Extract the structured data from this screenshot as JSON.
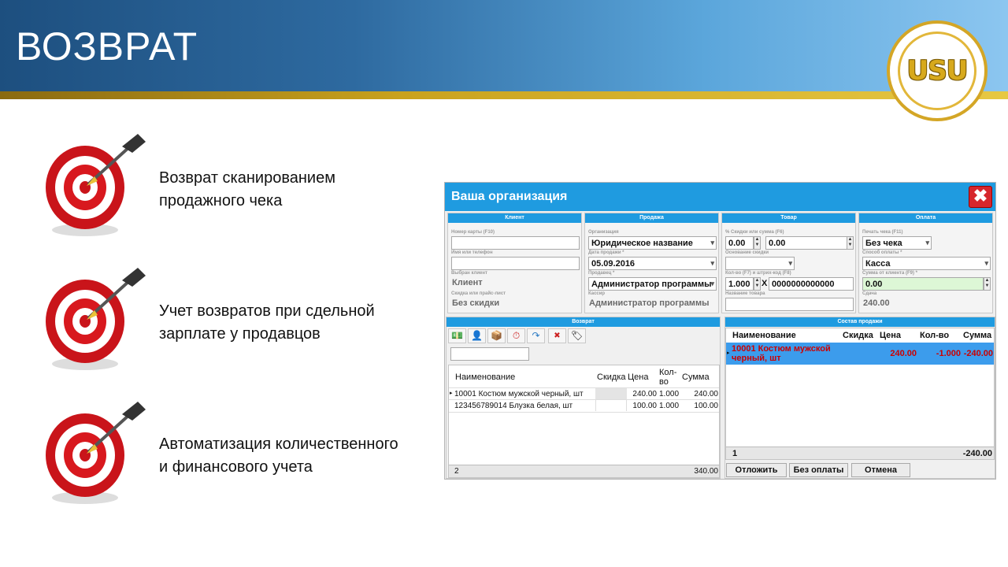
{
  "slide": {
    "title": "ВОЗВРАТ",
    "logo_text": "USU",
    "bullets": [
      {
        "line1": "Возврат сканированием",
        "line2": "продажного чека"
      },
      {
        "line1": "Учет возвратов при сдельной",
        "line2": "зарплате у продавцов"
      },
      {
        "line1": "Автоматизация количественного",
        "line2": "и финансового учета"
      }
    ]
  },
  "app": {
    "window_title": "Ваша организация",
    "close_glyph": "✖",
    "client": {
      "header": "Клиент",
      "card_label": "Номер карты (F10)",
      "name_label": "Имя или телефон",
      "selected_label": "Выбран клиент",
      "selected_value": "Клиент",
      "discount_label": "Скидка или прайс-лист",
      "discount_value": "Без скидки"
    },
    "sale": {
      "header": "Продажа",
      "org_label": "Организация",
      "org_value": "Юридическое название",
      "date_label": "Дата продажи *",
      "date_value": "05.09.2016",
      "seller_label": "Продавец *",
      "seller_value": "Администратор программы",
      "cashier_label": "Кассир",
      "cashier_value": "Администратор программы"
    },
    "product": {
      "header": "Товар",
      "discount_label": "% Скидки или сумма (F6)",
      "discount_pct": "0.00",
      "discount_sum": "0.00",
      "reason_label": "Основание скидки",
      "qty_label": "Кол-во (F7) и штрих-код (F8)",
      "qty_value": "1.000",
      "times": "X",
      "barcode_value": "0000000000000",
      "name_label": "Название товара"
    },
    "payment": {
      "header": "Оплата",
      "print_label": "Печать чека (F11)",
      "print_value": "Без чека",
      "method_label": "Способ оплаты *",
      "method_value": "Касса",
      "amount_label": "Сумма от клиента (F9) *",
      "amount_value": "0.00",
      "change_label": "Сдача",
      "change_value": "240.00"
    },
    "return_panel": {
      "header": "Возврат",
      "toolbar_icons": [
        "money-icon",
        "user-icon",
        "box-icon",
        "clock-icon",
        "undo-icon",
        "delete-icon",
        "tag-icon"
      ],
      "toolbar_glyphs": [
        "💵",
        "👤",
        "📦",
        "⏱",
        "↷",
        "✖",
        "🏷"
      ],
      "columns": [
        "Наименование",
        "Скидка",
        "Цена",
        "Кол-во",
        "Сумма"
      ],
      "rows": [
        {
          "name": "10001 Костюм мужской черный, шт",
          "discount": "",
          "price": "240.00",
          "qty": "1.000",
          "sum": "240.00"
        },
        {
          "name": "123456789014 Блузка белая, шт",
          "discount": "",
          "price": "100.00",
          "qty": "1.000",
          "sum": "100.00"
        }
      ],
      "footer_count": "2",
      "footer_sum": "340.00"
    },
    "sale_items": {
      "header": "Состав продажи",
      "columns": [
        "Наименование",
        "Скидка",
        "Цена",
        "Кол-во",
        "Сумма"
      ],
      "rows": [
        {
          "name_line1": "10001 Костюм мужской",
          "name_line2": "черный, шт",
          "discount": "",
          "price": "240.00",
          "qty": "-1.000",
          "sum": "-240.00"
        }
      ],
      "footer_count": "1",
      "footer_sum": "-240.00"
    },
    "buttons": {
      "postpone": "Отложить",
      "no_payment": "Без оплаты",
      "cancel": "Отмена"
    },
    "colors": {
      "accent": "#1f9be0",
      "selected_row": "#3c9cec",
      "error_text": "#cc0000",
      "amount_bg": "#ddf7d6"
    }
  }
}
